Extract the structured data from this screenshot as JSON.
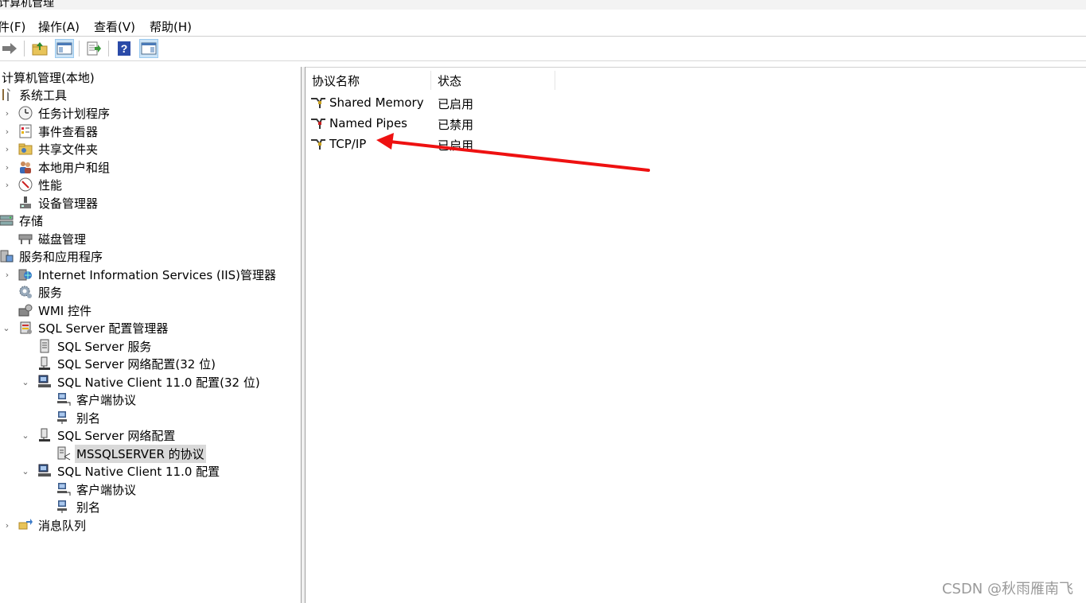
{
  "window": {
    "title": "计算机管理"
  },
  "menu": [
    {
      "label": "件(F)"
    },
    {
      "label": "操作(A)"
    },
    {
      "label": "查看(V)"
    },
    {
      "label": "帮助(H)"
    }
  ],
  "toolbar": {
    "buttons": [
      {
        "icon": "forward-arrow-icon"
      },
      {
        "icon": "up-folder-icon"
      },
      {
        "icon": "show-hide-console-tree-icon"
      },
      {
        "icon": "export-list-icon"
      },
      {
        "icon": "help-icon"
      },
      {
        "icon": "show-hide-action-pane-icon"
      }
    ]
  },
  "tree": {
    "root": "计算机管理(本地)",
    "items": [
      {
        "label": "系统工具",
        "icon": "tools-icon"
      },
      {
        "label": "任务计划程序",
        "icon": "clock-icon"
      },
      {
        "label": "事件查看器",
        "icon": "event-viewer-icon"
      },
      {
        "label": "共享文件夹",
        "icon": "shared-folder-icon"
      },
      {
        "label": "本地用户和组",
        "icon": "users-icon"
      },
      {
        "label": "性能",
        "icon": "performance-icon"
      },
      {
        "label": "设备管理器",
        "icon": "device-manager-icon"
      },
      {
        "label": "存储",
        "icon": "storage-icon"
      },
      {
        "label": "磁盘管理",
        "icon": "disk-icon"
      },
      {
        "label": "服务和应用程序",
        "icon": "services-apps-icon"
      },
      {
        "label": "Internet Information Services (IIS)管理器",
        "icon": "iis-icon"
      },
      {
        "label": "服务",
        "icon": "gear-icon"
      },
      {
        "label": "WMI 控件",
        "icon": "wmi-icon"
      },
      {
        "label": "SQL Server 配置管理器",
        "icon": "sql-config-icon"
      },
      {
        "label": "SQL Server 服务",
        "icon": "server-icon"
      },
      {
        "label": "SQL Server 网络配置(32 位)",
        "icon": "network-config-icon"
      },
      {
        "label": "SQL Native Client 11.0 配置(32 位)",
        "icon": "native-client-icon"
      },
      {
        "label": "客户端协议",
        "icon": "client-protocol-icon"
      },
      {
        "label": "别名",
        "icon": "alias-icon"
      },
      {
        "label": "SQL Server 网络配置",
        "icon": "network-config-icon"
      },
      {
        "label": "MSSQLSERVER 的协议",
        "icon": "protocol-icon"
      },
      {
        "label": "SQL Native Client 11.0 配置",
        "icon": "native-client-icon"
      },
      {
        "label": "客户端协议",
        "icon": "client-protocol-icon"
      },
      {
        "label": "别名",
        "icon": "alias-icon"
      },
      {
        "label": "消息队列",
        "icon": "message-queue-icon"
      }
    ]
  },
  "list": {
    "columns": [
      "协议名称",
      "状态"
    ],
    "rows": [
      {
        "name": "Shared Memory",
        "state": "已启用",
        "icon": "protocol-plug-icon"
      },
      {
        "name": "Named Pipes",
        "state": "已禁用",
        "icon": "protocol-plug-icon"
      },
      {
        "name": "TCP/IP",
        "state": "已启用",
        "icon": "protocol-plug-icon"
      }
    ]
  },
  "annotation": {
    "icon": "red-arrow-icon",
    "color": "#ee1111"
  },
  "watermark": "CSDN @秋雨雁南飞"
}
